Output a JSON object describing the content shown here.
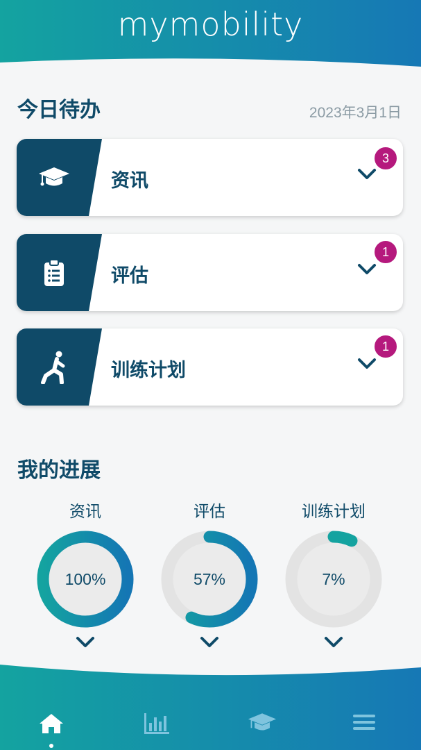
{
  "app": {
    "title": "mymobility"
  },
  "today": {
    "title": "今日待办",
    "date": "2023年3月1日",
    "tasks": [
      {
        "label": "资讯",
        "badge": "3",
        "icon": "graduation-cap-icon"
      },
      {
        "label": "评估",
        "badge": "1",
        "icon": "clipboard-list-icon"
      },
      {
        "label": "训练计划",
        "badge": "1",
        "icon": "stretching-person-icon"
      }
    ]
  },
  "progress": {
    "title": "我的进展",
    "items": [
      {
        "label": "资讯",
        "value_text": "100%",
        "fraction": 1.0
      },
      {
        "label": "评估",
        "value_text": "57%",
        "fraction": 0.57
      },
      {
        "label": "训练计划",
        "value_text": "7%",
        "fraction": 0.07
      }
    ]
  },
  "nav": {
    "items": [
      {
        "icon": "home-icon",
        "active": true
      },
      {
        "icon": "bar-chart-icon",
        "active": false
      },
      {
        "icon": "graduation-cap-icon",
        "active": false
      },
      {
        "icon": "menu-icon",
        "active": false
      }
    ]
  },
  "colors": {
    "primary_dark": "#0f4a68",
    "teal": "#14a3a0",
    "blue": "#1476b4",
    "badge": "#b5197d",
    "ring_track": "#e3e3e3"
  }
}
